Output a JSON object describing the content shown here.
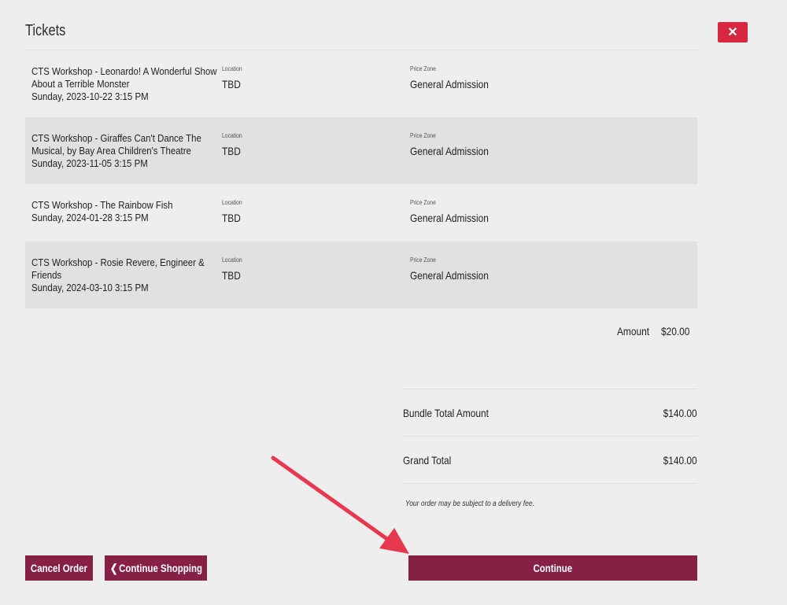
{
  "header": {
    "title": "Tickets",
    "close_label": "✕"
  },
  "tickets": [
    {
      "name_lines": [
        "CTS Workshop - Leonardo! A Wonderful Show",
        "About a Terrible Monster",
        "Sunday, 2023-10-22 3:15 PM"
      ],
      "location_label": "Location",
      "location": "TBD",
      "price_zone_label": "Price Zone",
      "price_zone": "General Admission"
    },
    {
      "name_lines": [
        "CTS Workshop - Giraffes Can't Dance The",
        "Musical, by Bay Area Children's Theatre",
        "Sunday, 2023-11-05 3:15 PM"
      ],
      "location_label": "Location",
      "location": "TBD",
      "price_zone_label": "Price Zone",
      "price_zone": "General Admission"
    },
    {
      "name_lines": [
        "CTS Workshop - The Rainbow Fish",
        "Sunday, 2024-01-28 3:15 PM"
      ],
      "location_label": "Location",
      "location": "TBD",
      "price_zone_label": "Price Zone",
      "price_zone": "General Admission"
    },
    {
      "name_lines": [
        "CTS Workshop - Rosie Revere, Engineer &",
        "Friends",
        "Sunday, 2024-03-10 3:15 PM"
      ],
      "location_label": "Location",
      "location": "TBD",
      "price_zone_label": "Price Zone",
      "price_zone": "General Admission"
    }
  ],
  "amount": {
    "label": "Amount",
    "value": "$20.00"
  },
  "totals": {
    "bundle_label": "Bundle Total Amount",
    "bundle_value": "$140.00",
    "grand_label": "Grand Total",
    "grand_value": "$140.00",
    "fee_note": "Your order may be subject to a delivery fee."
  },
  "actions": {
    "cancel_label": "Cancel Order",
    "continue_shopping_label": "Continue Shopping",
    "continue_label": "Continue"
  },
  "colors": {
    "accent": "#862044",
    "close": "#d8283f",
    "annotation_arrow": "#e8384f"
  }
}
